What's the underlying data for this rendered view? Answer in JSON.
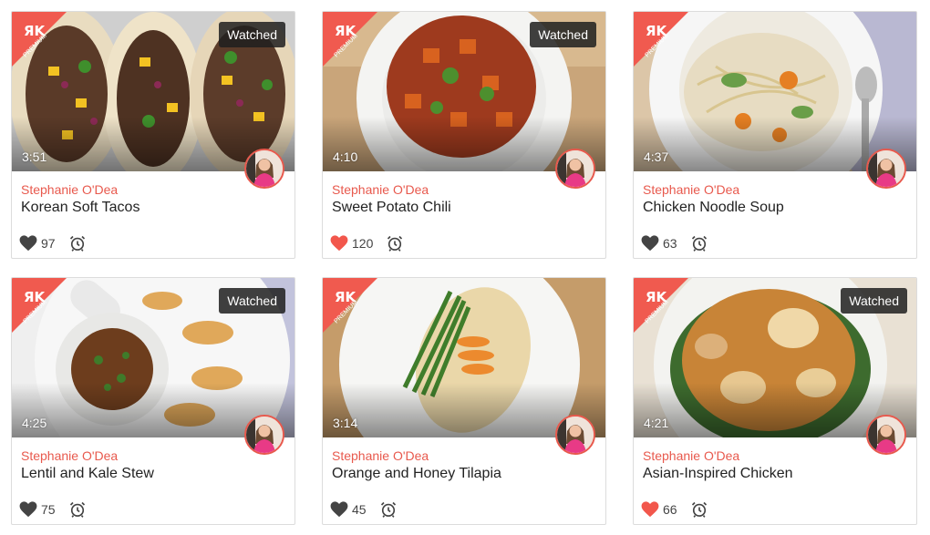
{
  "accent_color": "#e8594d",
  "liked_heart_color": "#f2574c",
  "default_heart_color": "#444444",
  "premium_badge_text": "PREMIUM",
  "watched_label": "Watched",
  "videos": [
    {
      "duration": "3:51",
      "author": "Stephanie O'Dea",
      "title": "Korean Soft Tacos",
      "likes": "97",
      "liked": false,
      "watched": true,
      "image": "tacos"
    },
    {
      "duration": "4:10",
      "author": "Stephanie O'Dea",
      "title": "Sweet Potato Chili",
      "likes": "120",
      "liked": true,
      "watched": true,
      "image": "chili"
    },
    {
      "duration": "4:37",
      "author": "Stephanie O'Dea",
      "title": "Chicken Noodle Soup",
      "likes": "63",
      "liked": false,
      "watched": false,
      "image": "soup"
    },
    {
      "duration": "4:25",
      "author": "Stephanie O'Dea",
      "title": "Lentil and Kale Stew",
      "likes": "75",
      "liked": false,
      "watched": true,
      "image": "stew"
    },
    {
      "duration": "3:14",
      "author": "Stephanie O'Dea",
      "title": "Orange and Honey Tilapia",
      "likes": "45",
      "liked": false,
      "watched": false,
      "image": "tilapia"
    },
    {
      "duration": "4:21",
      "author": "Stephanie O'Dea",
      "title": "Asian-Inspired Chicken",
      "likes": "66",
      "liked": true,
      "watched": true,
      "image": "chicken"
    }
  ]
}
